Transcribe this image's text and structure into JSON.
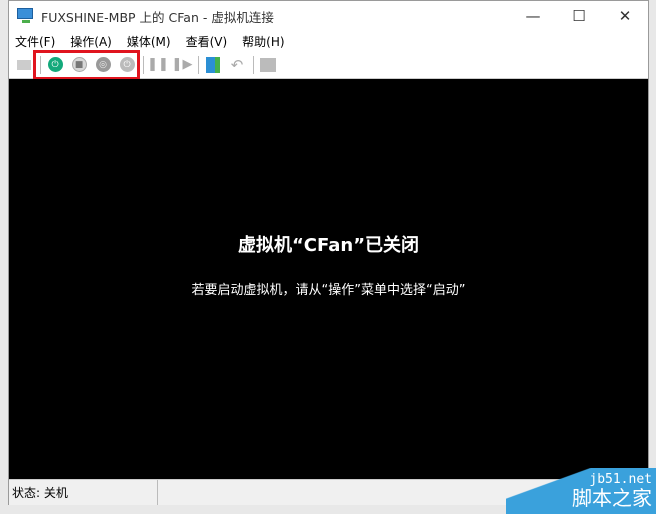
{
  "window": {
    "title": "FUXSHINE-MBP 上的 CFan - 虚拟机连接",
    "minimize": "—",
    "maximize": "☐",
    "close": "✕"
  },
  "menu": [
    {
      "label": "文件(F)"
    },
    {
      "label": "操作(A)"
    },
    {
      "label": "媒体(M)"
    },
    {
      "label": "查看(V)"
    },
    {
      "label": "帮助(H)"
    }
  ],
  "toolbar": {
    "start_color": "#13a97b",
    "highlight_color": "#e0141e"
  },
  "screen": {
    "title": "虚拟机“CFan”已关闭",
    "hint": "若要启动虚拟机，请从“操作”菜单中选择“启动”"
  },
  "status": {
    "text": "状态: 关机"
  },
  "watermark": {
    "line1": "jb51.net",
    "line2": "脚本之家"
  }
}
